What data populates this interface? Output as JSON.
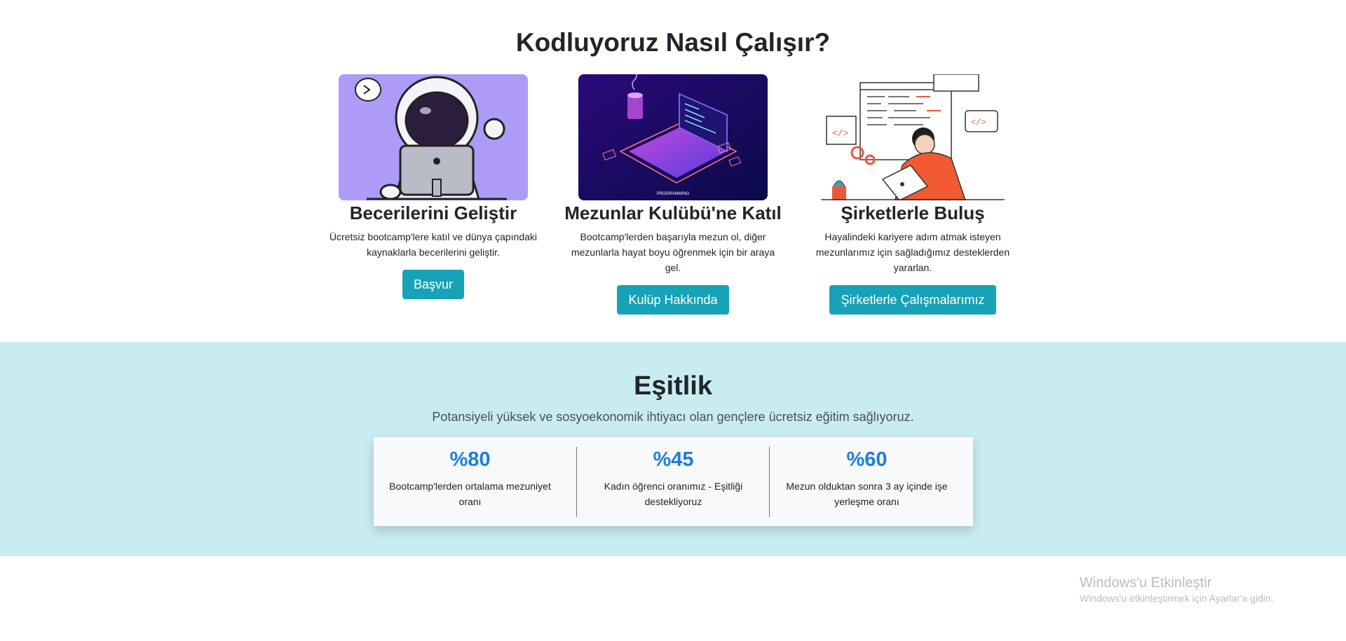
{
  "how": {
    "title": "Kodluyoruz Nasıl Çalışır?",
    "cards": [
      {
        "title": "Becerilerini Geliştir",
        "text": "Ücretsiz bootcamp'lere katıl ve dünya çapındaki kaynaklarla becerilerini geliştir.",
        "button": "Başvur",
        "image": "astronaut-laptop-illustration"
      },
      {
        "title": "Mezunlar Kulübü'ne Katıl",
        "text": "Bootcamp'lerden başarıyla mezun ol, diğer mezunlarla hayat boyu öğrenmek için bir araya gel.",
        "button": "Kulüp Hakkında",
        "image": "isometric-laptop-illustration",
        "image_caption": "PROGRAMMING"
      },
      {
        "title": "Şirketlerle Buluş",
        "text": "Hayalindeki kariyere adım atmak isteyen mezunlarımız için sağladığımız desteklerden yararlan.",
        "button": "Şirketlerle Çalışmalarımız",
        "image": "developer-at-desk-illustration"
      }
    ]
  },
  "equality": {
    "title": "Eşitlik",
    "subtitle": "Potansiyeli yüksek ve sosyoekonomik ihtiyacı olan gençlere ücretsiz eğitim sağlıyoruz.",
    "stats": [
      {
        "value": "%80",
        "label": "Bootcamp'lerden ortalama mezuniyet oranı"
      },
      {
        "value": "%45",
        "label": "Kadın öğrenci oranımız - Eşitliği destekliyoruz"
      },
      {
        "value": "%60",
        "label": "Mezun olduktan sonra 3 ay içinde işe yerleşme oranı"
      }
    ]
  },
  "watermark": {
    "title": "Windows'u Etkinleştir",
    "subtitle": "Windows'u etkinleştirmek için Ayarlar'a gidin."
  },
  "colors": {
    "button": "#17a2b8",
    "stat_number": "#1b7fe0",
    "equality_bg": "#c9ecf1"
  }
}
